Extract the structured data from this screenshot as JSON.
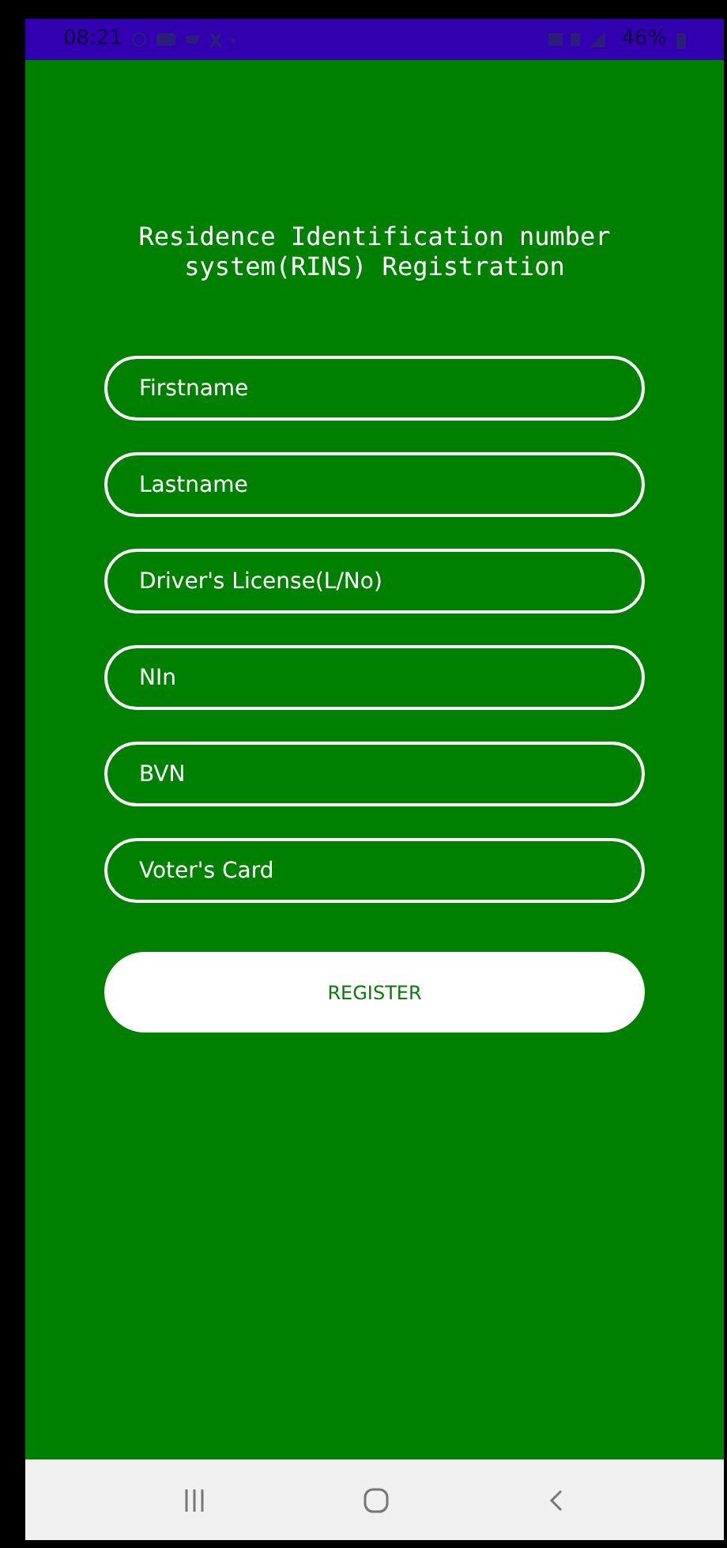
{
  "status_bar": {
    "time": "08:21",
    "battery": "46%"
  },
  "title": "Residence Identification number system(RINS) Registration",
  "fields": [
    {
      "placeholder": "Firstname"
    },
    {
      "placeholder": "Lastname"
    },
    {
      "placeholder": "Driver's License(L/No)"
    },
    {
      "placeholder": "NIn"
    },
    {
      "placeholder": "BVN"
    },
    {
      "placeholder": "Voter's Card"
    }
  ],
  "register_button": "REGISTER"
}
